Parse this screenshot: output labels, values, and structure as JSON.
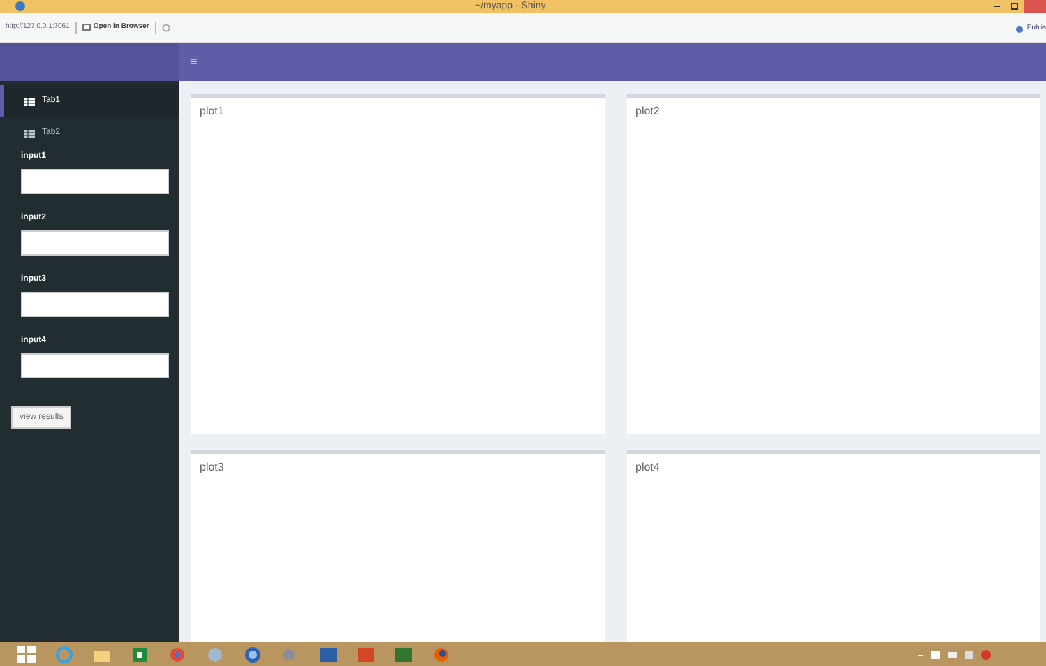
{
  "window": {
    "title": "~/myapp - Shiny"
  },
  "toolbar": {
    "address": "http://127.0.0.1:7061",
    "open_button": "Open in Browser",
    "publish_button": "Publis"
  },
  "header": {
    "menu_toggle": "≡"
  },
  "sidebar": {
    "items": [
      {
        "label": "Tab1",
        "selected": true
      },
      {
        "label": "Tab2",
        "selected": false
      }
    ],
    "inputs": [
      {
        "label": "input1"
      },
      {
        "label": "input2"
      },
      {
        "label": "input3"
      },
      {
        "label": "input4"
      }
    ],
    "button": "view results"
  },
  "boxes": [
    {
      "title": "plot1"
    },
    {
      "title": "plot2"
    },
    {
      "title": "plot3"
    },
    {
      "title": "plot4"
    }
  ]
}
